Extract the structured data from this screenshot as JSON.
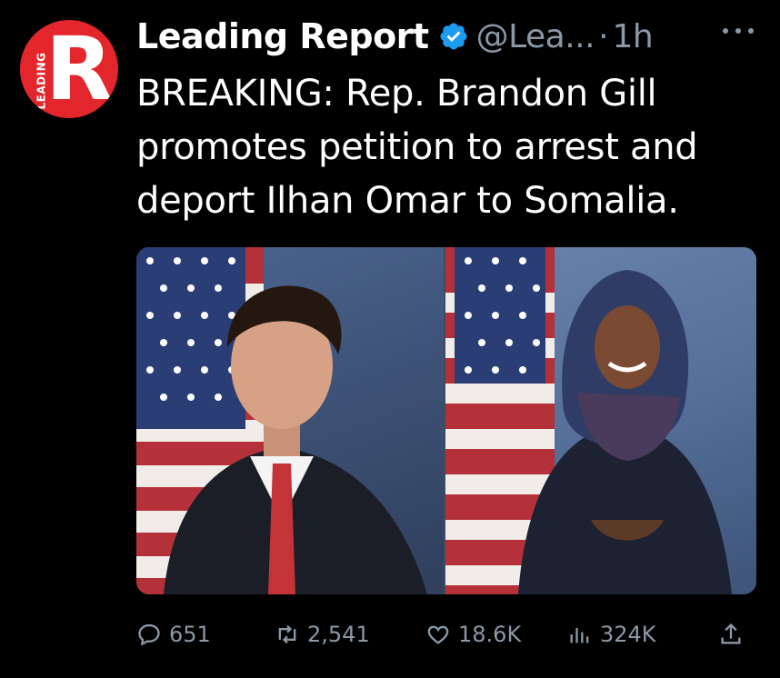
{
  "account": {
    "avatar_letter": "R",
    "avatar_side_text": "LEADING",
    "name": "Leading Report",
    "handle": "@Lea...",
    "separator": "·",
    "time": "1h",
    "verified_icon": "verified-badge-icon",
    "colors": {
      "avatar_bg": "#e3262c",
      "verified": "#1d9bf0"
    }
  },
  "tweet": {
    "lines": [
      "BREAKING: Rep. Brandon Gill",
      "promotes petition to arrest and",
      "deport Ilhan Omar to Somalia."
    ]
  },
  "media": {
    "images": [
      {
        "description": "portrait-flag-left",
        "icon": "photo"
      },
      {
        "description": "portrait-flag-right",
        "icon": "photo"
      }
    ]
  },
  "actions": {
    "replies": "651",
    "retweets": "2,541",
    "likes": "18.6K",
    "views": "324K",
    "icons": [
      "reply-icon",
      "retweet-icon",
      "like-icon",
      "views-icon",
      "share-icon"
    ]
  }
}
